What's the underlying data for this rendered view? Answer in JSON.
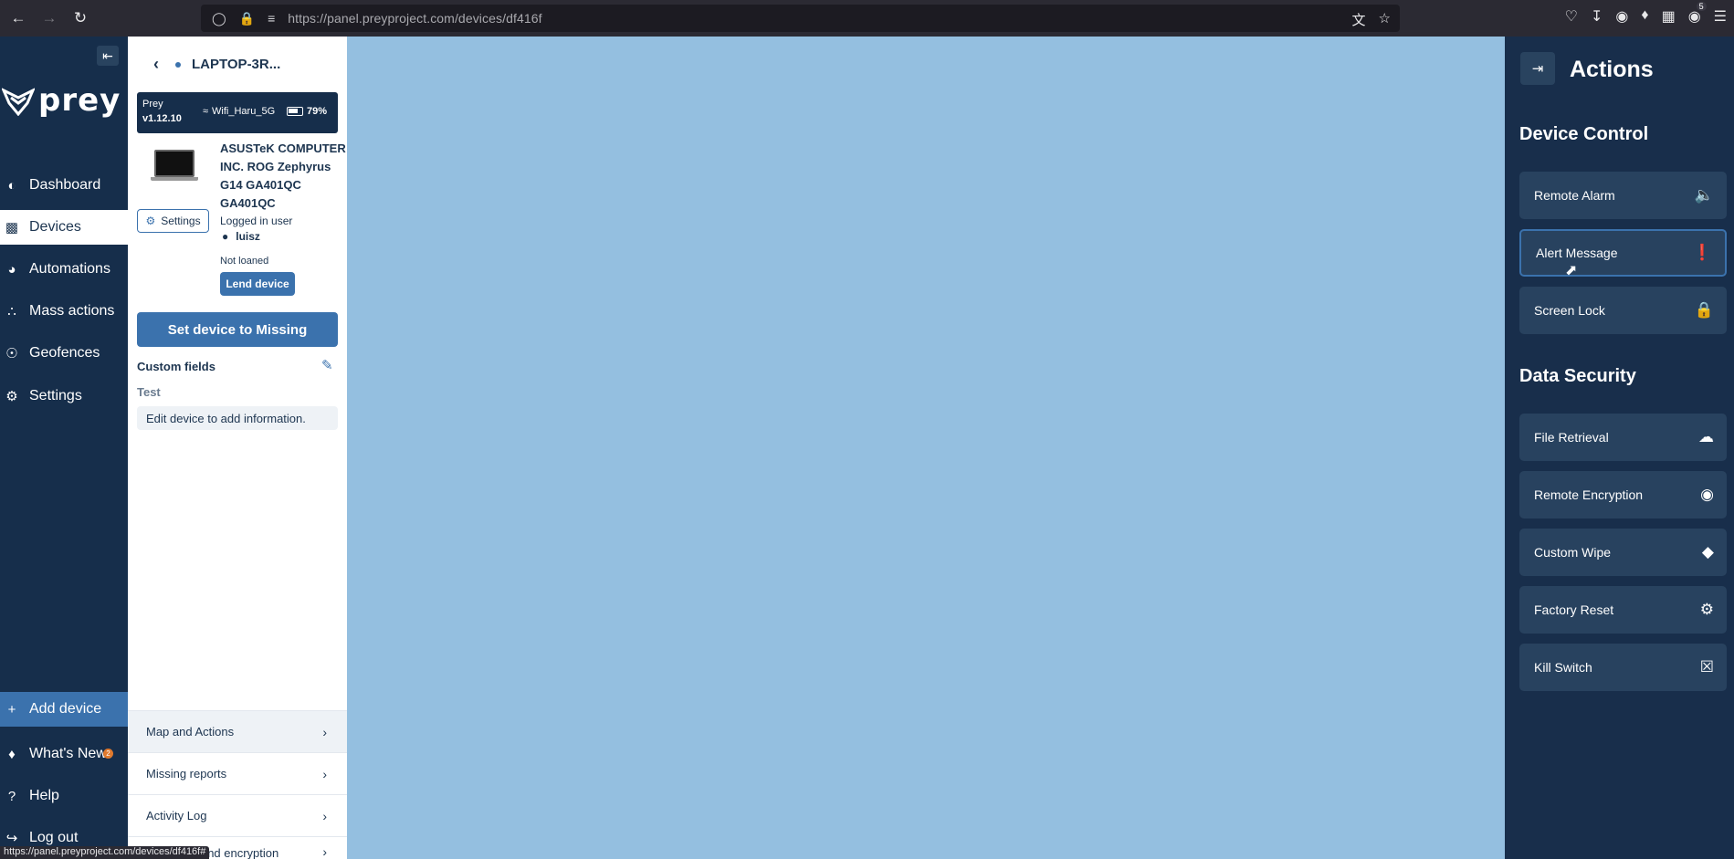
{
  "browser": {
    "url": "https://panel.preyproject.com/devices/df416f",
    "ext_badge": "5",
    "status_url": "https://panel.preyproject.com/devices/df416f#"
  },
  "left_nav": {
    "logo": "prey",
    "items": [
      {
        "label": "Dashboard",
        "icon": "dashboard-icon"
      },
      {
        "label": "Devices",
        "icon": "laptop-icon"
      },
      {
        "label": "Automations",
        "icon": "robot-icon"
      },
      {
        "label": "Mass actions",
        "icon": "nodes-icon"
      },
      {
        "label": "Geofences",
        "icon": "pin-icon"
      },
      {
        "label": "Settings",
        "icon": "gear-icon"
      }
    ],
    "add_device": "Add device",
    "whats_new": "What's New",
    "whats_new_count": "2",
    "help": "Help",
    "logout": "Log out"
  },
  "device": {
    "name": "LAPTOP-3R...",
    "prey_label": "Prey",
    "prey_version": "v1.12.10",
    "wifi": "Wifi_Haru_5G",
    "battery": "79%",
    "model": "ASUSTeK COMPUTER INC. ROG Zephyrus G14 GA401QC GA401QC",
    "settings_label": "Settings",
    "logged_in_label": "Logged in user",
    "user": "luisz",
    "loan_status": "Not loaned",
    "lend_label": "Lend device",
    "missing_label": "Set device to Missing",
    "custom_fields_title": "Custom fields",
    "custom_field_name": "Test",
    "custom_field_empty": "Edit device to add information.",
    "menu": [
      "Map and Actions",
      "Missing reports",
      "Activity Log",
      "Hardware and encryption information"
    ]
  },
  "actions": {
    "title": "Actions",
    "device_control_title": "Device Control",
    "device_control": [
      {
        "label": "Remote Alarm",
        "icon": "speaker-icon"
      },
      {
        "label": "Alert Message",
        "icon": "alert-icon"
      },
      {
        "label": "Screen Lock",
        "icon": "lock-icon"
      }
    ],
    "data_security_title": "Data Security",
    "data_security": [
      {
        "label": "File Retrieval",
        "icon": "cloud-download-icon"
      },
      {
        "label": "Remote Encryption",
        "icon": "encryption-lock-icon"
      },
      {
        "label": "Custom Wipe",
        "icon": "eraser-icon"
      },
      {
        "label": "Factory Reset",
        "icon": "gear-icon"
      },
      {
        "label": "Kill Switch",
        "icon": "x-box-icon"
      }
    ]
  },
  "colors": {
    "nav_bg": "#162e4b",
    "accent": "#3b72ad",
    "map_bg": "#94bfe0",
    "actions_btn": "#28425f"
  }
}
